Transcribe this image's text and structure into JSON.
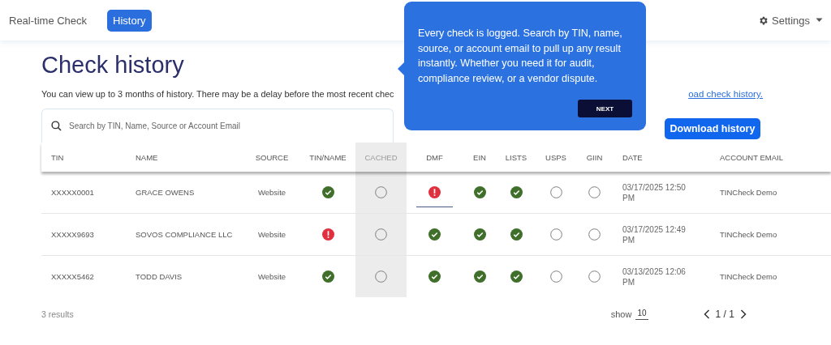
{
  "nav": {
    "tabs": [
      {
        "label": "Real-time Check",
        "selected": false
      },
      {
        "label": "History",
        "selected": true
      }
    ],
    "settings": {
      "label": "Settings"
    }
  },
  "page": {
    "title": "Check history",
    "intro": "You can view up to 3 months of history. There may be a delay before the most recent chec",
    "intro_link": "oad check history."
  },
  "search": {
    "placeholder": "Search by TIN, Name, Source or Account Email"
  },
  "download_button": "Download history",
  "tooltip": {
    "text": "Every check is logged. Search by TIN, name, source, or account email to pull up any result instantly. Whether you need it for audit, compliance review, or a vendor dispute.",
    "button": "NEXT"
  },
  "table": {
    "columns": [
      {
        "label": "TIN",
        "kind": "text",
        "shaded": false
      },
      {
        "label": "NAME",
        "kind": "text",
        "shaded": false
      },
      {
        "label": "SOURCE",
        "kind": "center",
        "shaded": false
      },
      {
        "label": "TIN/NAME",
        "kind": "center",
        "shaded": false
      },
      {
        "label": "CACHED",
        "kind": "center",
        "shaded": true
      },
      {
        "label": "DMF",
        "kind": "center",
        "shaded": false
      },
      {
        "label": "EIN",
        "kind": "center",
        "shaded": false
      },
      {
        "label": "LISTS",
        "kind": "center",
        "shaded": false
      },
      {
        "label": "USPS",
        "kind": "center",
        "shaded": false
      },
      {
        "label": "GIIN",
        "kind": "center",
        "shaded": false
      },
      {
        "label": "DATE",
        "kind": "text",
        "shaded": false
      },
      {
        "label": "ACCOUNT EMAIL",
        "kind": "text",
        "shaded": false
      }
    ],
    "rows": [
      {
        "tin": "XXXXX0001",
        "name": "GRACE OWENS",
        "source": "Website",
        "checks": [
          {
            "kind": "pass",
            "underlined": false
          },
          {
            "kind": "none",
            "underlined": false
          },
          {
            "kind": "fail",
            "underlined": true
          },
          {
            "kind": "pass",
            "underlined": false
          },
          {
            "kind": "pass",
            "underlined": false
          },
          {
            "kind": "none",
            "underlined": false
          },
          {
            "kind": "none",
            "underlined": false
          }
        ],
        "date": "03/17/2025 12:50 PM",
        "account_email": "TINCheck Demo"
      },
      {
        "tin": "XXXXX9693",
        "name": "SOVOS COMPLIANCE LLC",
        "source": "Website",
        "checks": [
          {
            "kind": "fail",
            "underlined": false
          },
          {
            "kind": "none",
            "underlined": false
          },
          {
            "kind": "pass",
            "underlined": false
          },
          {
            "kind": "pass",
            "underlined": false
          },
          {
            "kind": "pass",
            "underlined": false
          },
          {
            "kind": "none",
            "underlined": false
          },
          {
            "kind": "none",
            "underlined": false
          }
        ],
        "date": "03/17/2025 12:49 PM",
        "account_email": "TINCheck Demo"
      },
      {
        "tin": "XXXXX5462",
        "name": "TODD DAVIS",
        "source": "Website",
        "checks": [
          {
            "kind": "pass",
            "underlined": false
          },
          {
            "kind": "none",
            "underlined": false
          },
          {
            "kind": "pass",
            "underlined": false
          },
          {
            "kind": "pass",
            "underlined": false
          },
          {
            "kind": "pass",
            "underlined": false
          },
          {
            "kind": "none",
            "underlined": false
          },
          {
            "kind": "none",
            "underlined": false
          }
        ],
        "date": "03/13/2025 12:06 PM",
        "account_email": "TINCheck Demo"
      }
    ]
  },
  "footer": {
    "results": "3 results",
    "show_label": "show",
    "page_size": "10",
    "page": "1 / 1"
  }
}
